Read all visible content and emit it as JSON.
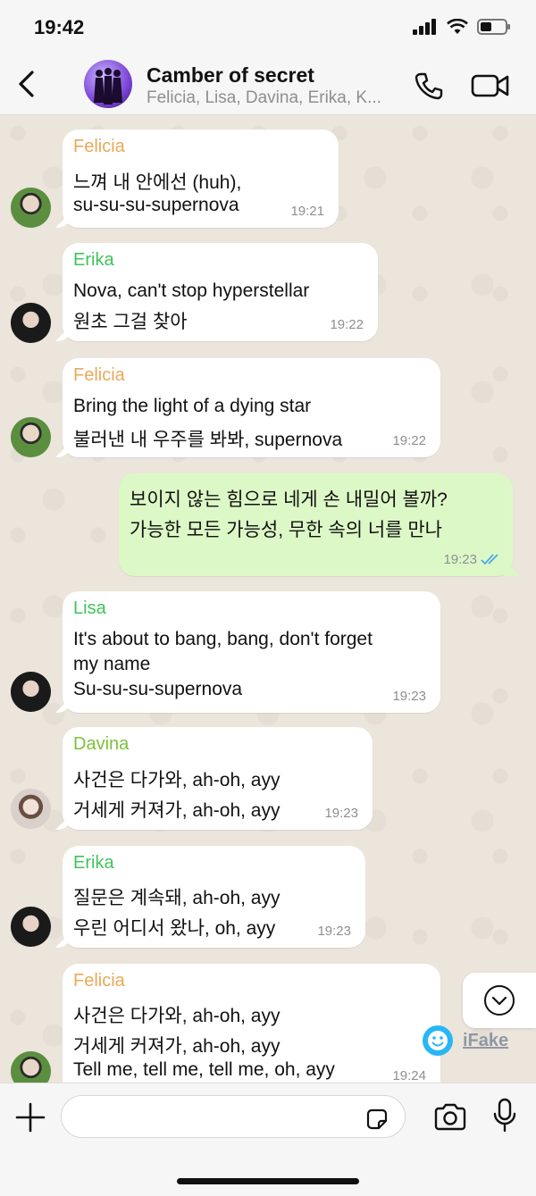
{
  "status": {
    "time": "19:42"
  },
  "header": {
    "title": "Camber of secret",
    "members": "Felicia, Lisa, Davina, Erika, K..."
  },
  "colors": {
    "felicia": "#e8a95a",
    "erika": "#3ec45a",
    "lisa": "#3ec45a",
    "davina": "#7cc23a",
    "outgoing_bubble": "#dcf8c6",
    "read_check": "#4fa7e8"
  },
  "messages": [
    {
      "sender": "Felicia",
      "lines": [
        "느껴 내 안에선 (huh),",
        "su-su-su-supernova"
      ],
      "time": "19:21"
    },
    {
      "sender": "Erika",
      "lines": [
        "Nova, can't stop hyperstellar",
        "원초 그걸 찾아"
      ],
      "time": "19:22"
    },
    {
      "sender": "Felicia",
      "lines": [
        "Bring the light of a dying star",
        "불러낸 내 우주를 봐봐, supernova"
      ],
      "time": "19:22"
    },
    {
      "sender": "",
      "lines": [
        "보이지 않는 힘으로 네게 손 내밀어 볼까?",
        "가능한 모든 가능성, 무한 속의 너를 만나"
      ],
      "time": "19:23"
    },
    {
      "sender": "Lisa",
      "lines": [
        "It's about to bang, bang, don't forget",
        "my name",
        "Su-su-su-supernova"
      ],
      "time": "19:23"
    },
    {
      "sender": "Davina",
      "lines": [
        "사건은 다가와, ah-oh, ayy",
        "거세게 커져가, ah-oh, ayy"
      ],
      "time": "19:23"
    },
    {
      "sender": "Erika",
      "lines": [
        "질문은 계속돼, ah-oh, ayy",
        "우린 어디서 왔나, oh, ayy"
      ],
      "time": "19:23"
    },
    {
      "sender": "Felicia",
      "lines": [
        "사건은 다가와, ah-oh, ayy",
        "거세게 커져가, ah-oh, ayy",
        "Tell me, tell me, tell me, oh, ayy"
      ],
      "time": "19:24"
    }
  ],
  "watermark": {
    "text": "iFake"
  },
  "composer": {
    "placeholder": ""
  },
  "icons": [
    "back-icon",
    "phone-icon",
    "video-camera-icon",
    "chevron-down-icon",
    "plus-icon",
    "sticker-icon",
    "camera-icon",
    "microphone-icon",
    "double-check-icon"
  ]
}
